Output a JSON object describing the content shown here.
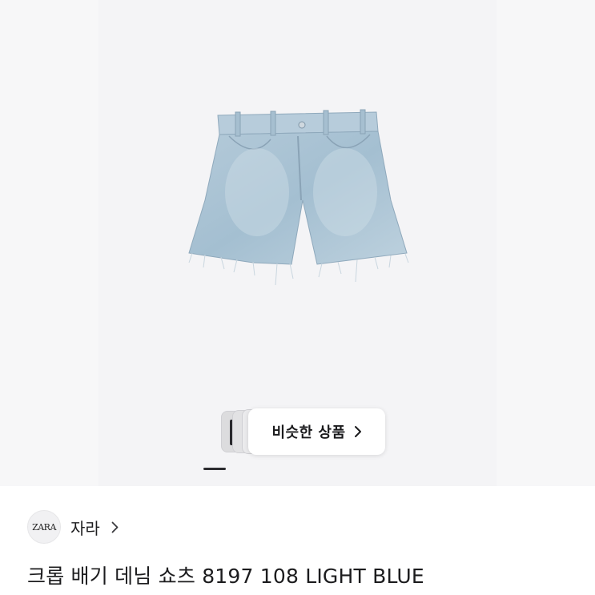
{
  "similar": {
    "label": "비슷한 상품",
    "icon": "chevron-right-icon"
  },
  "shop": {
    "logo_text": "ZARA",
    "name": "자라",
    "icon": "chevron-right-icon"
  },
  "product": {
    "title": "크롭 배기 데님 쇼츠 8197 108 LIGHT BLUE",
    "image_subject": "light blue denim shorts"
  },
  "carousel": {
    "current_index": 1
  },
  "colors": {
    "background": "#f4f4f6",
    "denim": "#a9c3d6",
    "text": "#1c1c1e"
  }
}
